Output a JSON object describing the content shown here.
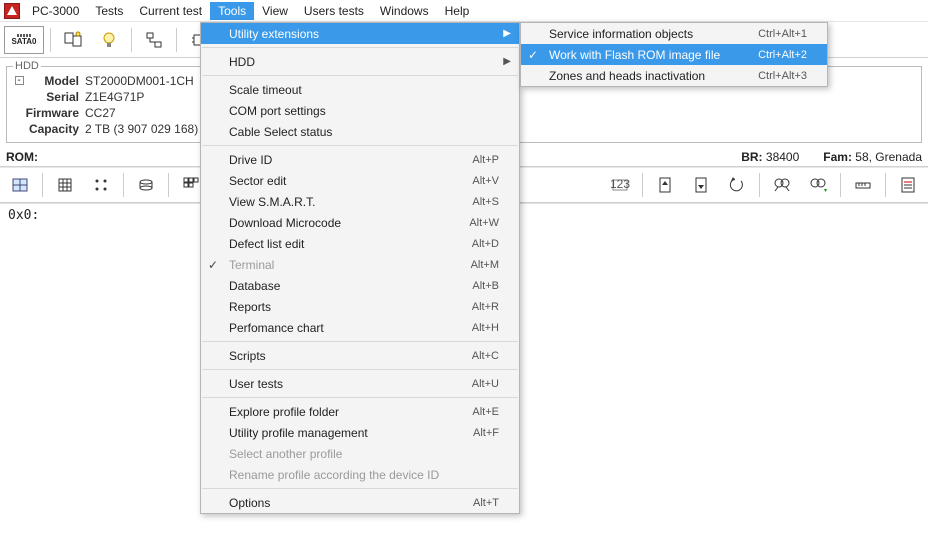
{
  "menubar": {
    "items": [
      "PC-3000",
      "Tests",
      "Current test",
      "Tools",
      "View",
      "Users tests",
      "Windows",
      "Help"
    ],
    "active_index": 3
  },
  "toolbar1": {
    "sata_label": "SATA0",
    "icons": [
      "port-icon",
      "devices-icon",
      "bulb-icon",
      "net-icon",
      "chip-icon",
      "gauge-icon",
      "smart-icon",
      "list-icon"
    ]
  },
  "hdd_info": {
    "legend": "HDD",
    "model_label": "Model",
    "model": "ST2000DM001-1CH",
    "serial_label": "Serial",
    "serial": "Z1E4G71P",
    "firmware_label": "Firmware",
    "firmware": "CC27",
    "capacity_label": "Capacity",
    "capacity": "2 TB (3 907 029 168)"
  },
  "rom_row": {
    "rom_label": "ROM:",
    "br_label": "BR:",
    "br_value": "38400",
    "fam_label": "Fam:",
    "fam_value": "58, Grenada"
  },
  "toolbar2": {
    "icons": [
      "map-icon",
      "grid-icon",
      "dots-icon",
      "disks-icon",
      "nine-icon",
      "script-icon",
      "hex-icon",
      "pageup-icon",
      "pagedn-icon",
      "undo-icon",
      "find-icon",
      "findnext-icon",
      "ruler-icon",
      "note-icon"
    ]
  },
  "hex_area": {
    "prompt": "0x0:"
  },
  "tools_menu": {
    "items": [
      {
        "label": "Utility extensions",
        "submenu": true,
        "highlight": true
      },
      {
        "sep": true
      },
      {
        "label": "HDD",
        "submenu": true
      },
      {
        "sep": true
      },
      {
        "label": "Scale timeout"
      },
      {
        "label": "COM port settings"
      },
      {
        "label": "Cable Select status"
      },
      {
        "sep": true
      },
      {
        "label": "Drive ID",
        "shortcut": "Alt+P"
      },
      {
        "label": "Sector edit",
        "shortcut": "Alt+V"
      },
      {
        "label": "View S.M.A.R.T.",
        "shortcut": "Alt+S"
      },
      {
        "label": "Download Microcode",
        "shortcut": "Alt+W"
      },
      {
        "label": "Defect list edit",
        "shortcut": "Alt+D"
      },
      {
        "label": "Terminal",
        "shortcut": "Alt+M",
        "disabled": true,
        "checked": true
      },
      {
        "label": "Database",
        "shortcut": "Alt+B"
      },
      {
        "label": "Reports",
        "shortcut": "Alt+R"
      },
      {
        "label": "Perfomance chart",
        "shortcut": "Alt+H"
      },
      {
        "sep": true
      },
      {
        "label": "Scripts",
        "shortcut": "Alt+C"
      },
      {
        "sep": true
      },
      {
        "label": "User tests",
        "shortcut": "Alt+U"
      },
      {
        "sep": true
      },
      {
        "label": "Explore profile folder",
        "shortcut": "Alt+E"
      },
      {
        "label": "Utility profile management",
        "shortcut": "Alt+F"
      },
      {
        "label": "Select another profile",
        "disabled": true
      },
      {
        "label": "Rename profile according the device ID",
        "disabled": true
      },
      {
        "sep": true
      },
      {
        "label": "Options",
        "shortcut": "Alt+T"
      }
    ]
  },
  "utility_ext_submenu": {
    "items": [
      {
        "label": "Service information objects",
        "shortcut": "Ctrl+Alt+1"
      },
      {
        "label": "Work with Flash ROM image file",
        "shortcut": "Ctrl+Alt+2",
        "highlight": true,
        "checked": true
      },
      {
        "label": "Zones and heads inactivation",
        "shortcut": "Ctrl+Alt+3"
      }
    ]
  }
}
